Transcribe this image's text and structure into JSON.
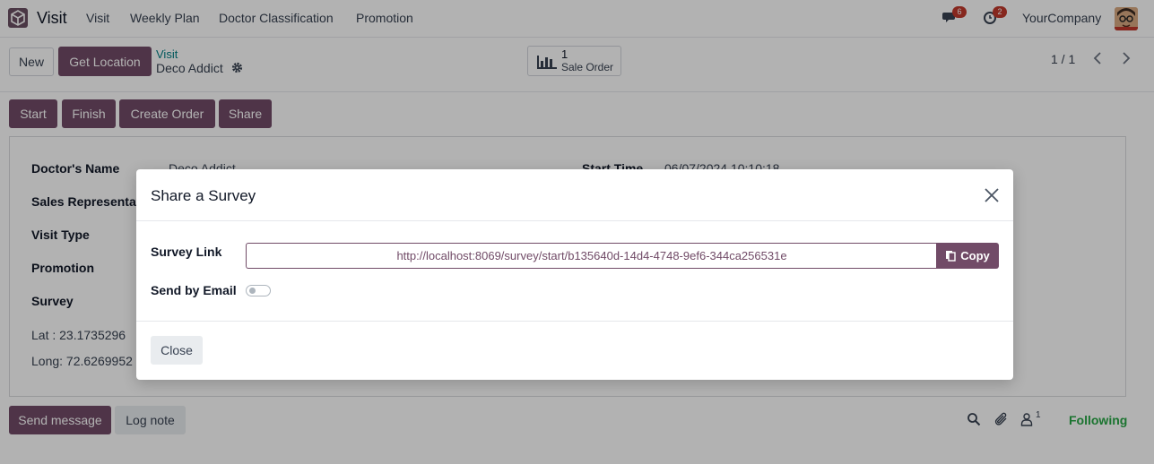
{
  "navbar": {
    "app_name": "Visit",
    "menu": [
      "Visit",
      "Weekly Plan",
      "Doctor Classification",
      "Promotion"
    ],
    "messages_count": "6",
    "activities_count": "2",
    "company": "YourCompany"
  },
  "control_panel": {
    "new_label": "New",
    "get_location_label": "Get Location",
    "breadcrumb": "Visit",
    "record_name": "Deco Addict",
    "smart_button": {
      "count": "1",
      "label": "Sale Order"
    },
    "pager": "1 / 1"
  },
  "status_buttons": [
    "Start",
    "Finish",
    "Create Order",
    "Share"
  ],
  "form": {
    "doctor_name_label": "Doctor's Name",
    "doctor_name_value": "Deco Addict",
    "sales_rep_label": "Sales Representat",
    "visit_type_label": "Visit Type",
    "promotion_label": "Promotion",
    "survey_label": "Survey",
    "lat_text": "Lat : 23.1735296",
    "long_text": "Long: 72.6269952",
    "start_time_label": "Start Time",
    "start_time_value": "06/07/2024 10:10:18"
  },
  "chatter": {
    "send_message_label": "Send message",
    "log_note_label": "Log note",
    "followers_count": "1",
    "following_label": "Following"
  },
  "modal": {
    "title": "Share a Survey",
    "survey_link_label": "Survey Link",
    "survey_link_value": "http://localhost:8069/survey/start/b135640d-14d4-4748-9ef6-344ca256531e",
    "copy_label": "Copy",
    "send_email_label": "Send by Email",
    "send_email_enabled": false,
    "close_label": "Close"
  },
  "colors": {
    "primary": "#714b67",
    "link": "#017e84",
    "following": "#28a745",
    "badge": "#c0392b"
  }
}
